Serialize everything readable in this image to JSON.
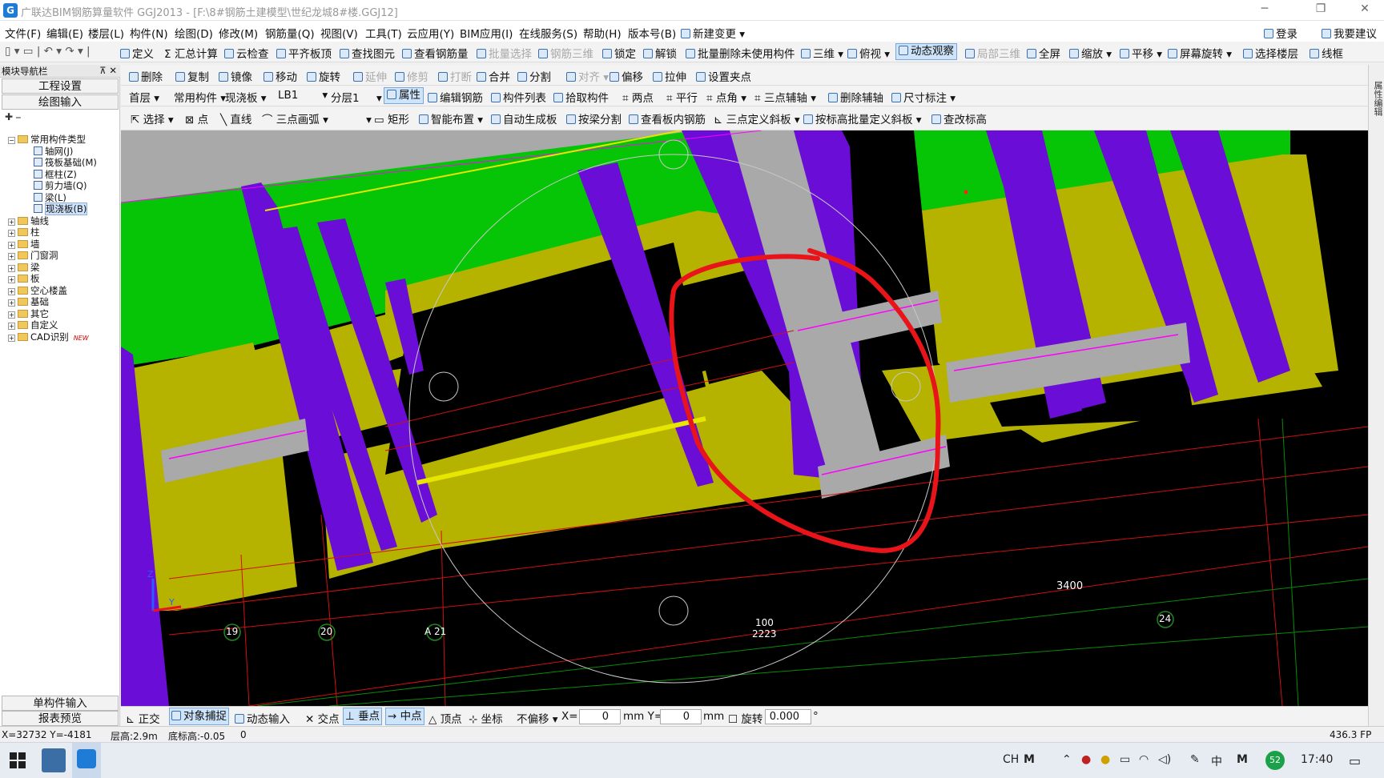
{
  "window": {
    "title": "广联达BIM钢筋算量软件 GGJ2013 - [F:\\8#钢筋土建模型\\世纪龙城8#楼.GGJ12]",
    "minimize": "─",
    "restore": "❐",
    "close": "✕"
  },
  "menu": {
    "items": [
      "文件(F)",
      "编辑(E)",
      "楼层(L)",
      "构件(N)",
      "绘图(D)",
      "修改(M)",
      "钢筋量(Q)",
      "视图(V)",
      "工具(T)",
      "云应用(Y)",
      "BIM应用(I)",
      "在线服务(S)",
      "帮助(H)",
      "版本号(B)",
      "新建变更"
    ],
    "login": "登录",
    "suggest": "我要建议"
  },
  "toolbar1": {
    "items": [
      "定义",
      "汇总计算",
      "云检查",
      "平齐板顶",
      "查找图元",
      "查看钢筋量",
      "批量选择",
      "钢筋三维",
      "锁定",
      "解锁",
      "批量删除未使用构件",
      "三维",
      "俯视",
      "动态观察",
      "局部三维",
      "全屏",
      "缩放",
      "平移",
      "屏幕旋转",
      "选择楼层",
      "线框"
    ]
  },
  "toolbar2": {
    "items": [
      "删除",
      "复制",
      "镜像",
      "移动",
      "旋转",
      "延伸",
      "修剪",
      "打断",
      "合并",
      "分割",
      "对齐",
      "偏移",
      "拉伸",
      "设置夹点"
    ]
  },
  "toolbar3": {
    "floor": "首层",
    "category": "常用构件",
    "type": "现浇板",
    "component": "LB1",
    "layer": "分层1",
    "items": [
      "属性",
      "编辑钢筋",
      "构件列表",
      "拾取构件",
      "两点",
      "平行",
      "点角",
      "三点辅轴",
      "删除辅轴",
      "尺寸标注"
    ]
  },
  "toolbar4": {
    "items": [
      "选择",
      "点",
      "直线",
      "三点画弧",
      "矩形",
      "智能布置",
      "自动生成板",
      "按梁分割",
      "查看板内钢筋",
      "三点定义斜板",
      "按标高批量定义斜板",
      "查改标高"
    ]
  },
  "leftpanel": {
    "header": "模块导航栏",
    "pin": "⊼ ✕",
    "project_settings": "工程设置",
    "drawing_input": "绘图输入",
    "tree": [
      {
        "label": "常用构件类型",
        "level": 0,
        "exp": "−"
      },
      {
        "label": "轴网(J)",
        "level": 2
      },
      {
        "label": "筏板基础(M)",
        "level": 2
      },
      {
        "label": "框柱(Z)",
        "level": 2
      },
      {
        "label": "剪力墙(Q)",
        "level": 2
      },
      {
        "label": "梁(L)",
        "level": 2
      },
      {
        "label": "现浇板(B)",
        "level": 2,
        "selected": true
      },
      {
        "label": "轴线",
        "level": 0,
        "exp": "+"
      },
      {
        "label": "柱",
        "level": 0,
        "exp": "+"
      },
      {
        "label": "墙",
        "level": 0,
        "exp": "+"
      },
      {
        "label": "门窗洞",
        "level": 0,
        "exp": "+"
      },
      {
        "label": "梁",
        "level": 0,
        "exp": "+"
      },
      {
        "label": "板",
        "level": 0,
        "exp": "+"
      },
      {
        "label": "空心楼盖",
        "level": 0,
        "exp": "+"
      },
      {
        "label": "基础",
        "level": 0,
        "exp": "+"
      },
      {
        "label": "其它",
        "level": 0,
        "exp": "+"
      },
      {
        "label": "自定义",
        "level": 0,
        "exp": "+"
      },
      {
        "label": "CAD识别",
        "level": 0,
        "exp": "+",
        "badge": "NEW"
      }
    ],
    "single_input": "单构件输入",
    "report_preview": "报表预览"
  },
  "rightstrip": {
    "label": "属性编辑"
  },
  "canvas": {
    "axis_labels": [
      "19",
      "20",
      "A 21",
      "100",
      "2223",
      "24"
    ],
    "dimension": "3400",
    "axis_z": "Z",
    "axis_y": "Y"
  },
  "snapbar": {
    "items": [
      "正交",
      "对象捕捉",
      "动态输入",
      "交点",
      "垂点",
      "中点",
      "顶点",
      "坐标",
      "不偏移"
    ],
    "x_label": "X=",
    "x_value": "0",
    "y_label": "mm Y=",
    "y_value": "0",
    "mm": "mm",
    "rotate_label": "旋转",
    "rotate_value": "0.000",
    "degree": "°"
  },
  "status": {
    "coords": "X=32732 Y=-4181",
    "floor_height": "层高:2.9m",
    "bottom_elev": "底标高:-0.05",
    "zero": "0",
    "fps": "436.3 FP"
  },
  "taskbar": {
    "ime1": "CH",
    "ime2": "M",
    "ime3": "中",
    "ime4": "M",
    "badge": "52",
    "time": "17:40"
  },
  "colors": {
    "column": "#6a0dd6",
    "slab": "#b5b300",
    "green": "#06c406",
    "beam_gray": "#a9a9a9",
    "annotation_red": "#e8141a"
  }
}
